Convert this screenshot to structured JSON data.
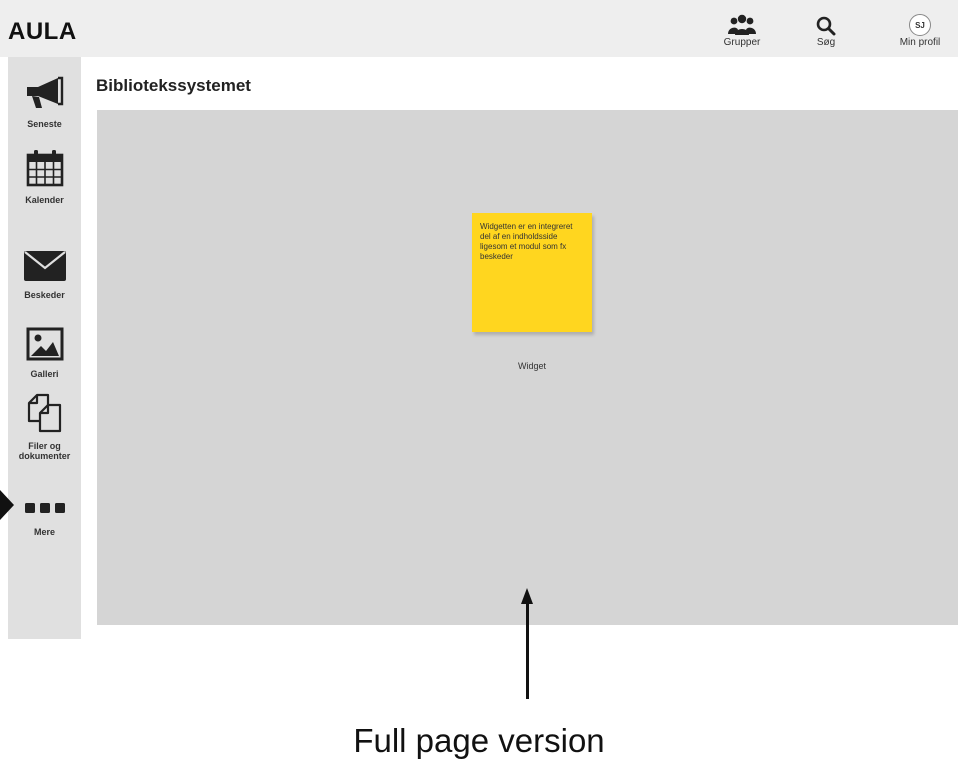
{
  "app": {
    "logo": "AULA"
  },
  "topnav": [
    {
      "label": "Grupper",
      "icon": "groups-icon"
    },
    {
      "label": "Søg",
      "icon": "search-icon"
    },
    {
      "label": "Min profil",
      "icon": "avatar",
      "initials": "SJ"
    }
  ],
  "sidebar": {
    "items": [
      {
        "label": "Seneste",
        "icon": "megaphone-icon"
      },
      {
        "label": "Kalender",
        "icon": "calendar-icon"
      },
      {
        "label": "Beskeder",
        "icon": "envelope-icon"
      },
      {
        "label": "Galleri",
        "icon": "image-icon"
      },
      {
        "label": "Filer og dokumenter",
        "icon": "documents-icon"
      },
      {
        "label": "Mere",
        "icon": "more-icon",
        "active": true
      }
    ]
  },
  "main": {
    "title": "Bibliotekssystemet",
    "widget": {
      "note": "Widgetten er en integreret del af en indholdsside ligesom et modul som fx beskeder",
      "label": "Widget",
      "note_color": "#ffd61f"
    }
  },
  "annotation": {
    "caption": "Full page version"
  },
  "colors": {
    "topbar": "#eeeeee",
    "sidebar": "#e0e0e0",
    "content": "#d5d5d5",
    "sticky": "#ffd61f"
  }
}
